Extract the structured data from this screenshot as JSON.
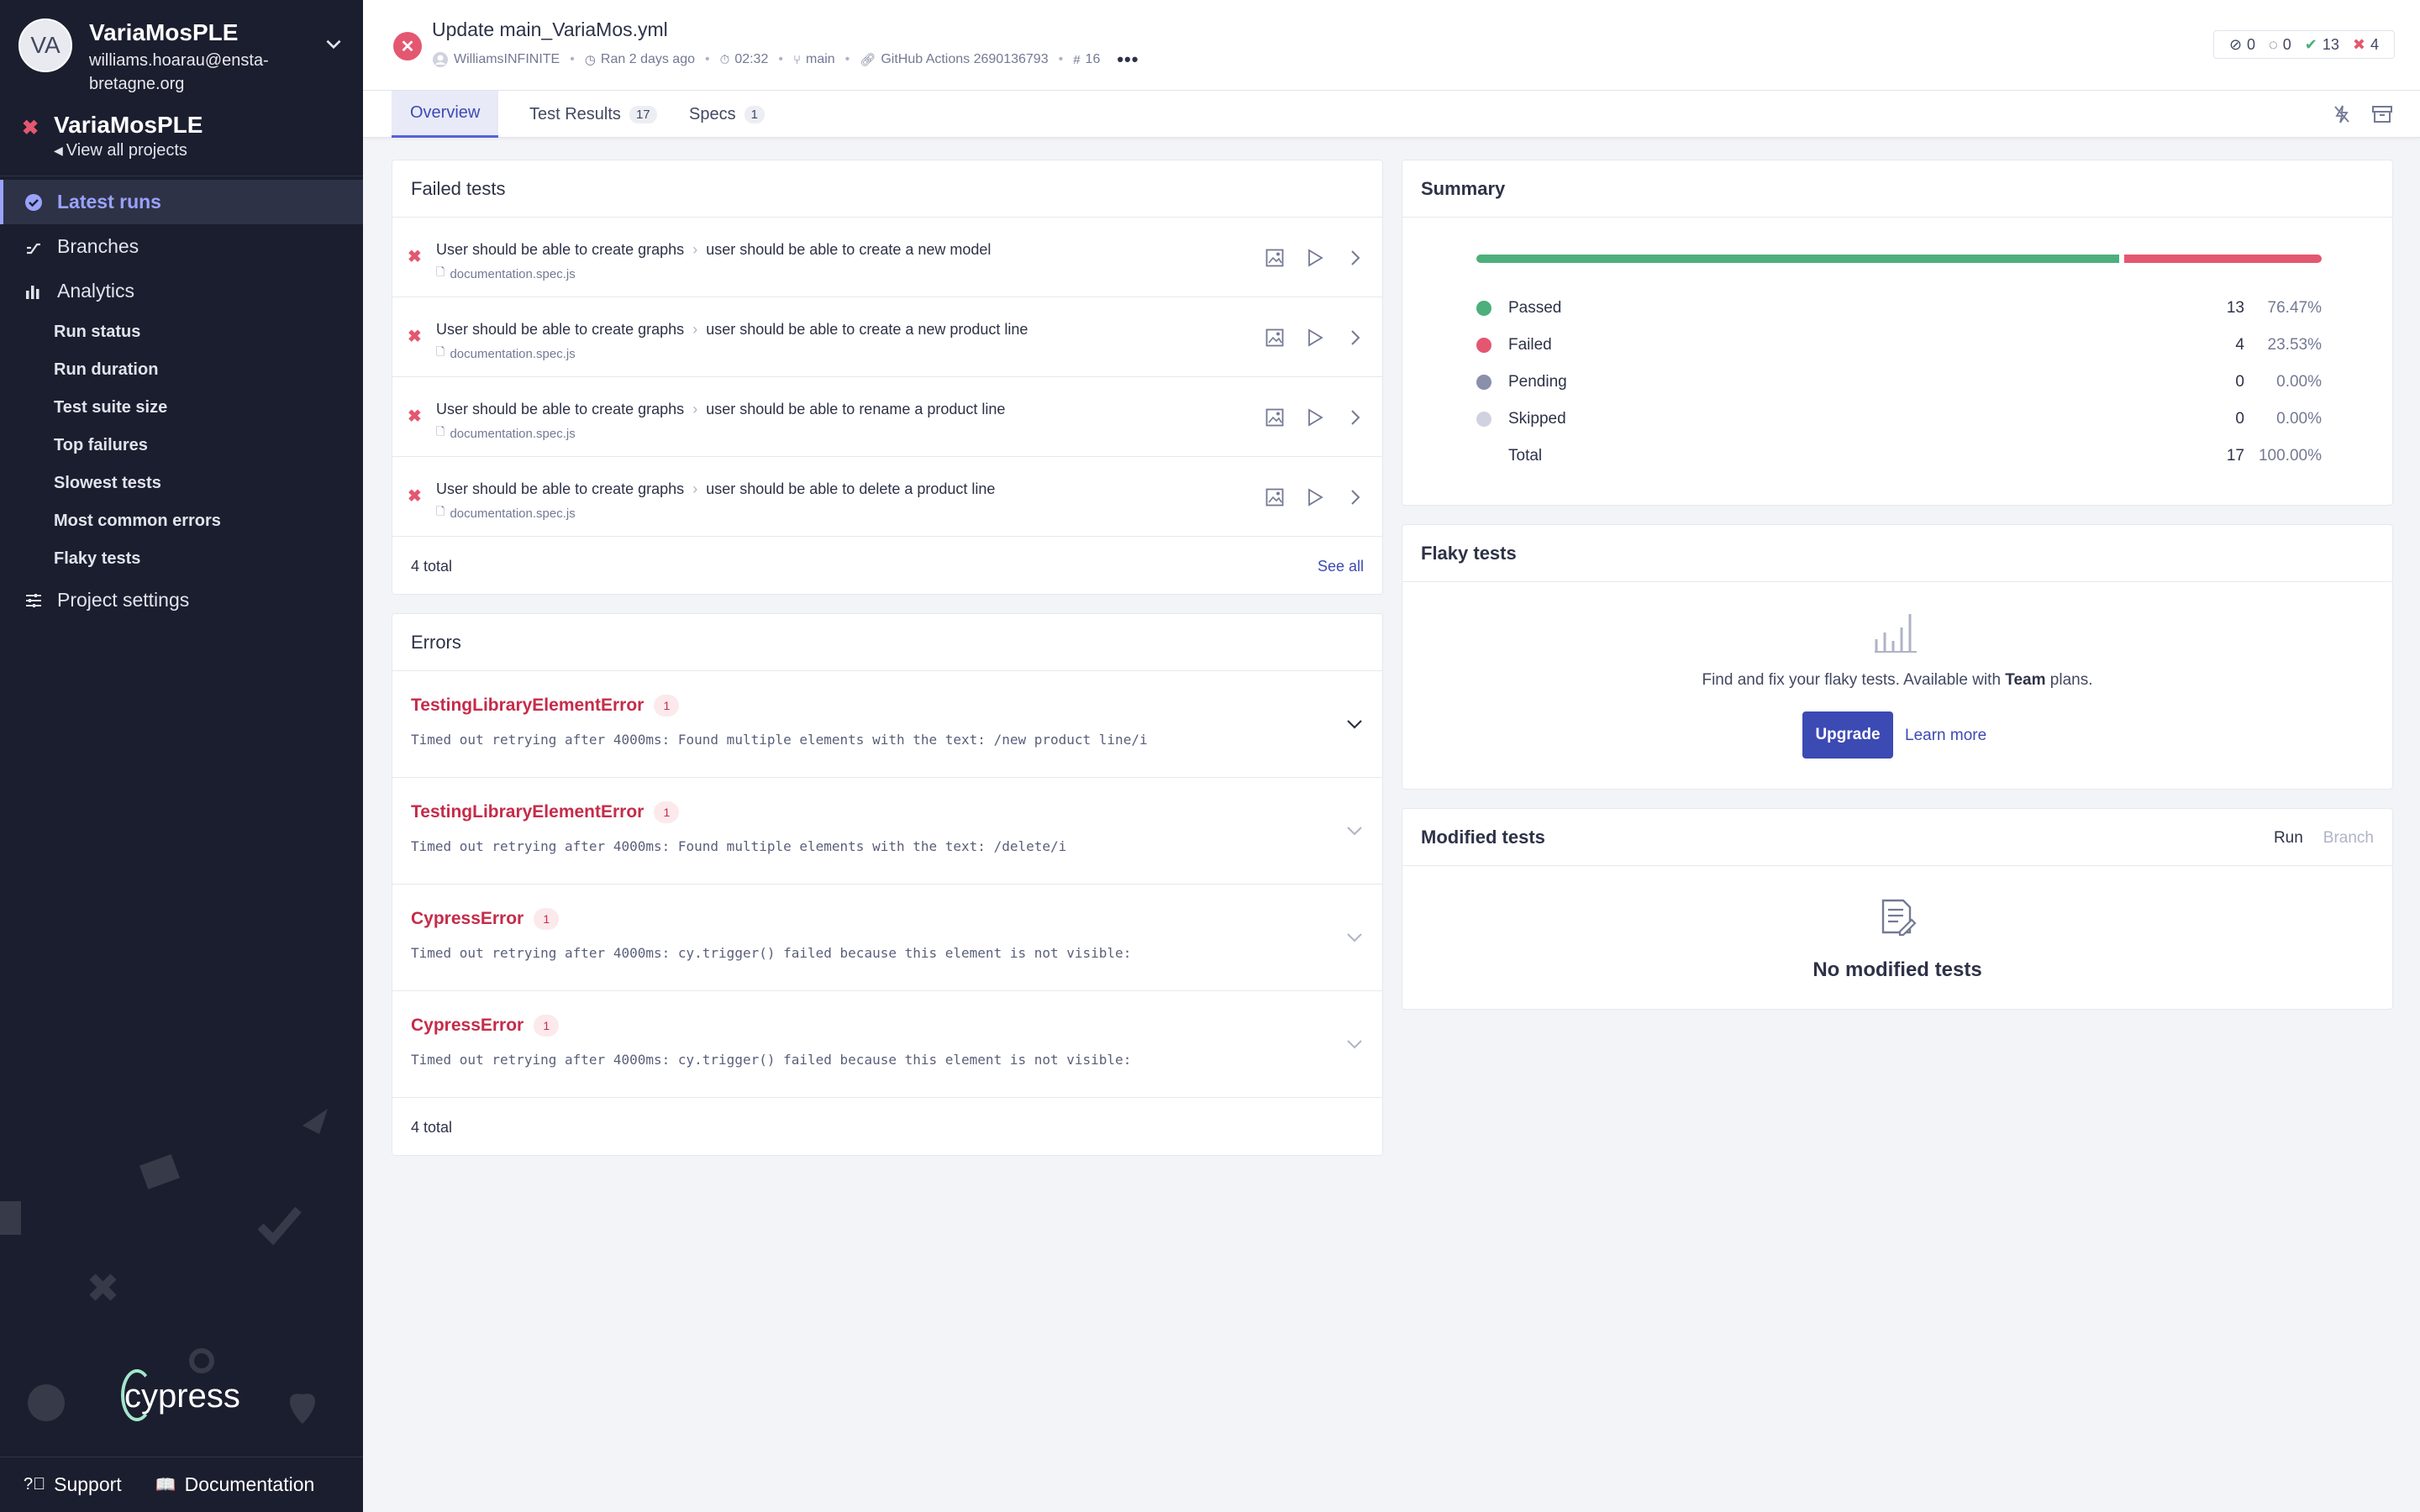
{
  "sidebar": {
    "org": {
      "initials": "VA",
      "name": "VariaMosPLE",
      "email": "williams.hoarau@ensta-bretagne.org"
    },
    "project": {
      "name": "VariaMosPLE",
      "view_all": "View all projects"
    },
    "nav": {
      "latest_runs": "Latest runs",
      "branches": "Branches",
      "analytics": "Analytics",
      "project_settings": "Project settings"
    },
    "analytics_items": [
      "Run status",
      "Run duration",
      "Test suite size",
      "Top failures",
      "Slowest tests",
      "Most common errors",
      "Flaky tests"
    ],
    "logo_text": "cypress",
    "footer": {
      "support": "Support",
      "documentation": "Documentation"
    }
  },
  "header": {
    "title": "Update main_VariaMos.yml",
    "author": "WilliamsINFINITE",
    "ran": "Ran 2 days ago",
    "duration": "02:32",
    "branch": "main",
    "ci": "GitHub Actions 2690136793",
    "run_number": "16",
    "counts": {
      "skipped": "0",
      "pending": "0",
      "passed": "13",
      "failed": "4"
    }
  },
  "tabs": [
    {
      "label": "Overview",
      "badge": ""
    },
    {
      "label": "Test Results",
      "badge": "17"
    },
    {
      "label": "Specs",
      "badge": "1"
    }
  ],
  "failed_tests": {
    "title": "Failed tests",
    "items": [
      {
        "suite": "User should be able to create graphs",
        "test": "user should be able to create a new model",
        "file": "documentation.spec.js"
      },
      {
        "suite": "User should be able to create graphs",
        "test": "user should be able to create a new product line",
        "file": "documentation.spec.js"
      },
      {
        "suite": "User should be able to create graphs",
        "test": "user should be able to rename a product line",
        "file": "documentation.spec.js"
      },
      {
        "suite": "User should be able to create graphs",
        "test": "user should be able to delete a product line",
        "file": "documentation.spec.js"
      }
    ],
    "total": "4 total",
    "see_all": "See all"
  },
  "errors": {
    "title": "Errors",
    "items": [
      {
        "name": "TestingLibraryElementError",
        "count": "1",
        "message": "Timed out retrying after 4000ms: Found multiple elements with the text: /new product line/i"
      },
      {
        "name": "TestingLibraryElementError",
        "count": "1",
        "message": "Timed out retrying after 4000ms: Found multiple elements with the text: /delete/i"
      },
      {
        "name": "CypressError",
        "count": "1",
        "message": "Timed out retrying after 4000ms: cy.trigger() failed because this element is not visible:"
      },
      {
        "name": "CypressError",
        "count": "1",
        "message": "Timed out retrying after 4000ms: cy.trigger() failed because this element is not visible:"
      }
    ],
    "total": "4 total"
  },
  "summary": {
    "title": "Summary",
    "passed_fraction": 0.7647,
    "rows": [
      {
        "label": "Passed",
        "count": "13",
        "pct": "76.47%",
        "color": "#4daf7b"
      },
      {
        "label": "Failed",
        "count": "4",
        "pct": "23.53%",
        "color": "#e45770"
      },
      {
        "label": "Pending",
        "count": "0",
        "pct": "0.00%",
        "color": "#8a8fab"
      },
      {
        "label": "Skipped",
        "count": "0",
        "pct": "0.00%",
        "color": "#d0d2df"
      },
      {
        "label": "Total",
        "count": "17",
        "pct": "100.00%",
        "color": ""
      }
    ]
  },
  "flaky": {
    "title": "Flaky tests",
    "text_before": "Find and fix your flaky tests. Available with ",
    "text_bold": "Team",
    "text_after": " plans.",
    "upgrade": "Upgrade",
    "learn_more": "Learn more"
  },
  "modified": {
    "title": "Modified tests",
    "run": "Run",
    "branch": "Branch",
    "empty": "No modified tests"
  },
  "colors": {
    "sidebar_bg": "#1b1e2e",
    "accent": "#3c4ab4",
    "pass": "#4daf7b",
    "fail": "#e45770"
  }
}
